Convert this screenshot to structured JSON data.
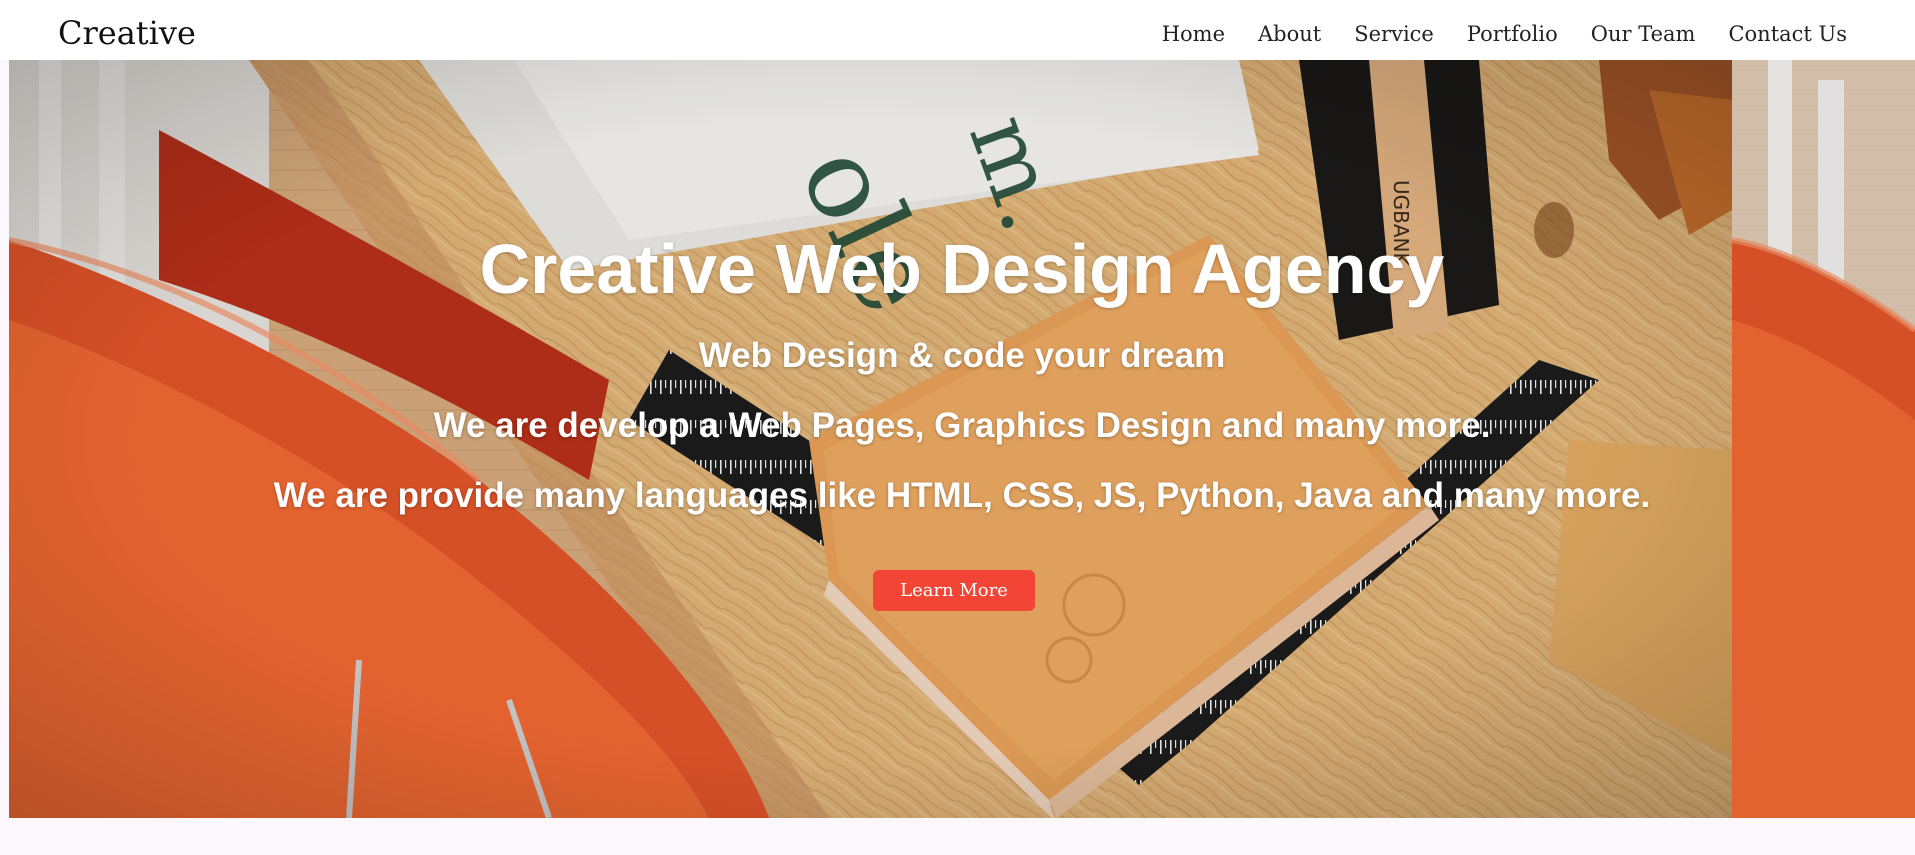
{
  "navbar": {
    "brand": "Creative",
    "links": [
      "Home",
      "About",
      "Service",
      "Portfolio",
      "Our Team",
      "Contact Us"
    ]
  },
  "hero": {
    "title": "Creative Web Design Agency",
    "subtitle": "Web Design & code your dream",
    "line1": "We are develop a Web Pages, Graphics Design and many more.",
    "line2": "We are provide many languages like HTML, CSS, JS, Python, Java and many more.",
    "cta_label": "Learn More"
  },
  "colors": {
    "accent": "#f24536",
    "nav_bg": "#ffffff",
    "page_bg": "#fdf8fd",
    "hero_text": "#ffffff"
  }
}
